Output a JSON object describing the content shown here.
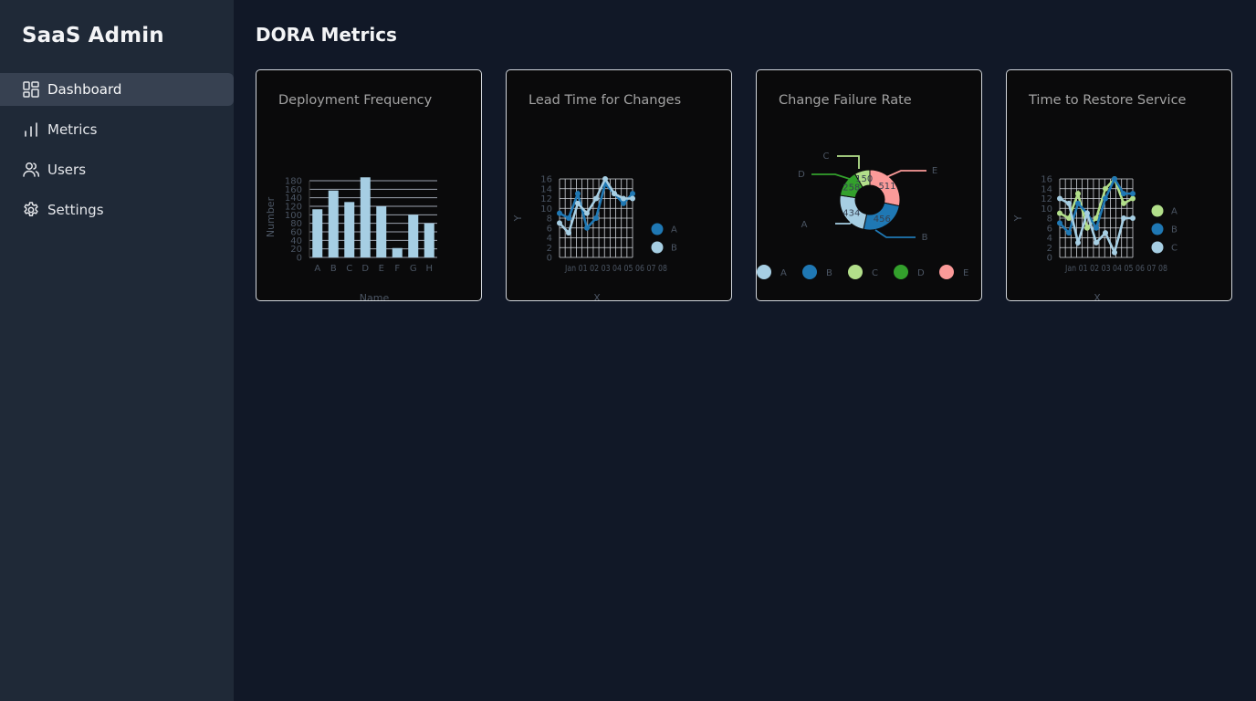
{
  "app": {
    "brand": "SaaS Admin"
  },
  "sidebar": {
    "items": [
      {
        "label": "Dashboard",
        "icon": "dashboard-icon",
        "active": true
      },
      {
        "label": "Metrics",
        "icon": "bar-chart-icon"
      },
      {
        "label": "Users",
        "icon": "users-icon"
      },
      {
        "label": "Settings",
        "icon": "gear-icon"
      }
    ]
  },
  "page": {
    "title": "DORA Metrics"
  },
  "cards": [
    {
      "title": "Deployment Frequency"
    },
    {
      "title": "Lead Time for Changes"
    },
    {
      "title": "Change Failure Rate"
    },
    {
      "title": "Time to Restore Service"
    }
  ],
  "colors": {
    "lightblue": "#a6cee3",
    "darkblue": "#1f78b4",
    "lightgreen": "#b2df8a",
    "green": "#33a02c",
    "pink": "#fb9a99",
    "sidebar_bg": "#1f2937",
    "page_bg": "#111827",
    "card_bg": "#0a0a0b"
  },
  "chart_data": [
    {
      "type": "bar",
      "categories": [
        "A",
        "B",
        "C",
        "D",
        "E",
        "F",
        "G",
        "H"
      ],
      "values": [
        113,
        157,
        130,
        188,
        120,
        22,
        100,
        80
      ],
      "xlabel": "Name",
      "ylabel": "Number",
      "ylim": [
        0,
        180
      ],
      "yticks": [
        0,
        20,
        40,
        60,
        80,
        100,
        120,
        140,
        160,
        180
      ],
      "grid": true
    },
    {
      "type": "line",
      "x": [
        "Jan",
        "01",
        "02",
        "03",
        "04",
        "05",
        "06",
        "07",
        "08"
      ],
      "x_tick_text": "Jan 01 02 03 04 05 06 07 08",
      "xlabel": "X",
      "ylabel": "Y",
      "ylim": [
        0,
        16
      ],
      "yticks": [
        0,
        2,
        4,
        6,
        8,
        10,
        12,
        14,
        16
      ],
      "series": [
        {
          "name": "A",
          "values": [
            9,
            8,
            13,
            6,
            8,
            15,
            13,
            11,
            13
          ]
        },
        {
          "name": "B",
          "values": [
            7,
            5,
            11,
            9,
            12,
            16,
            13,
            12,
            12
          ]
        }
      ],
      "legend": "right",
      "grid": true
    },
    {
      "type": "pie",
      "donut": true,
      "labels": [
        "A",
        "B",
        "C",
        "D",
        "E"
      ],
      "values": [
        434,
        456,
        150,
        258,
        511
      ],
      "legend": "bottom"
    },
    {
      "type": "line",
      "x": [
        "Jan",
        "01",
        "02",
        "03",
        "04",
        "05",
        "06",
        "07",
        "08"
      ],
      "x_tick_text": "Jan 01 02 03 04 05 06 07 08",
      "xlabel": "X",
      "ylabel": "Y",
      "ylim": [
        0,
        16
      ],
      "yticks": [
        0,
        2,
        4,
        6,
        8,
        10,
        12,
        14,
        16
      ],
      "series": [
        {
          "name": "A",
          "values": [
            9,
            8,
            13,
            6,
            8,
            14,
            16,
            11,
            12
          ]
        },
        {
          "name": "B",
          "values": [
            7,
            5,
            11,
            9,
            6,
            12,
            16,
            13,
            13
          ]
        },
        {
          "name": "C",
          "values": [
            12,
            11,
            3,
            9,
            3,
            5,
            1,
            8,
            8
          ]
        }
      ],
      "legend": "right",
      "grid": true
    }
  ]
}
